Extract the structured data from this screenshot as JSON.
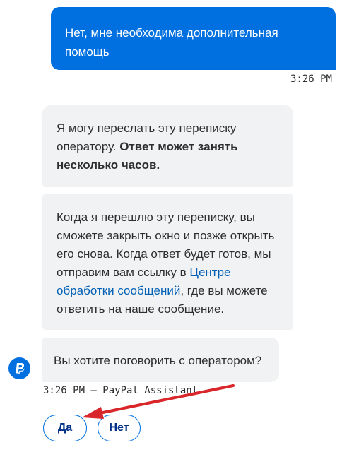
{
  "conversation": {
    "user_message": "Нет, мне необходима дополнительная помощь",
    "user_timestamp": "3:26 PM",
    "bot_message_1": {
      "text": "Я могу переслать эту переписку оператору. ",
      "bold": "Ответ может занять несколько часов."
    },
    "bot_message_2": {
      "before_link": "Когда я перешлю эту переписку, вы сможете закрыть окно и позже открыть его снова. Когда ответ будет готов, мы отправим вам ссылку в ",
      "link": "Центре обработки сообщений",
      "after_link": ", где вы можете ответить на наше сообщение."
    },
    "bot_message_3": "Вы хотите поговорить с оператором?",
    "bot_meta": "3:26 PM – PayPal Assistant"
  },
  "quick_replies": {
    "yes": "Да",
    "no": "Нет"
  },
  "colors": {
    "brand_blue": "#0070e0",
    "bubble_gray": "#f1f2f4",
    "link_blue": "#0060b6",
    "annotation_arrow": "#d9262b"
  },
  "icons": {
    "avatar": "paypal-logo-icon"
  }
}
